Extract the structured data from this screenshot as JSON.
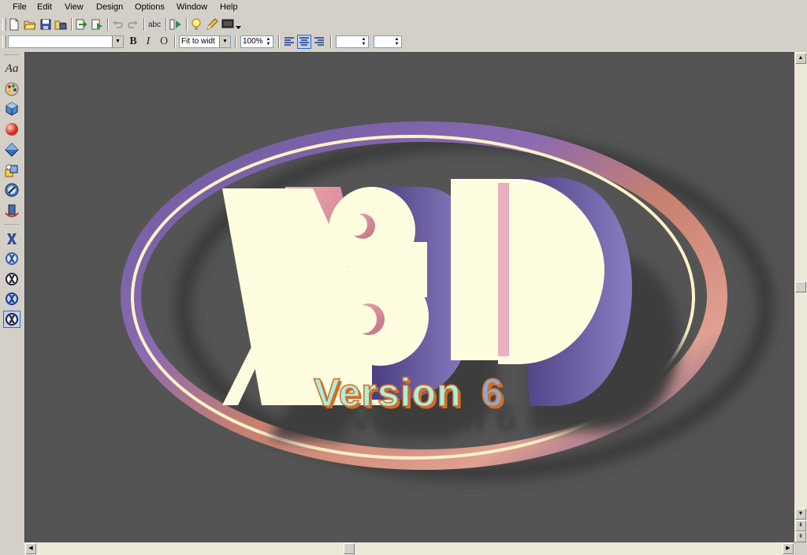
{
  "menu": {
    "items": [
      {
        "label": "File"
      },
      {
        "label": "Edit"
      },
      {
        "label": "View"
      },
      {
        "label": "Design"
      },
      {
        "label": "Options"
      },
      {
        "label": "Window"
      },
      {
        "label": "Help"
      }
    ]
  },
  "toolbar": {
    "style_combo_value": "",
    "bold_label": "B",
    "italic_label": "I",
    "outline_label": "O",
    "fit_combo_value": "Fit to widt",
    "zoom_value": "100%",
    "spin1_value": "",
    "spin2_value": "",
    "spell_label": "abc"
  },
  "palette": {
    "text_tool_label": "Aa"
  },
  "canvas": {
    "logo_text": "X3D",
    "version_word": "Version",
    "version_number": "6",
    "background_color": "#545454"
  },
  "colors": {
    "logo_face": "#fffde0",
    "logo_side_purple": "#6a5ca0",
    "logo_side_pink": "#e0909a",
    "ring_cream": "#fff2c8",
    "version_word": "#a8f0e0",
    "version_number": "#8aa8d0",
    "version_outline": "#d96a20"
  },
  "icons": [
    "new-file-icon",
    "open-icon",
    "save-icon",
    "save-all-icon",
    "import-icon",
    "run-icon",
    "undo-icon",
    "redo-icon",
    "spellcheck-icon",
    "preview-icon",
    "bulb-icon",
    "pencil-icon",
    "monitor-icon"
  ]
}
